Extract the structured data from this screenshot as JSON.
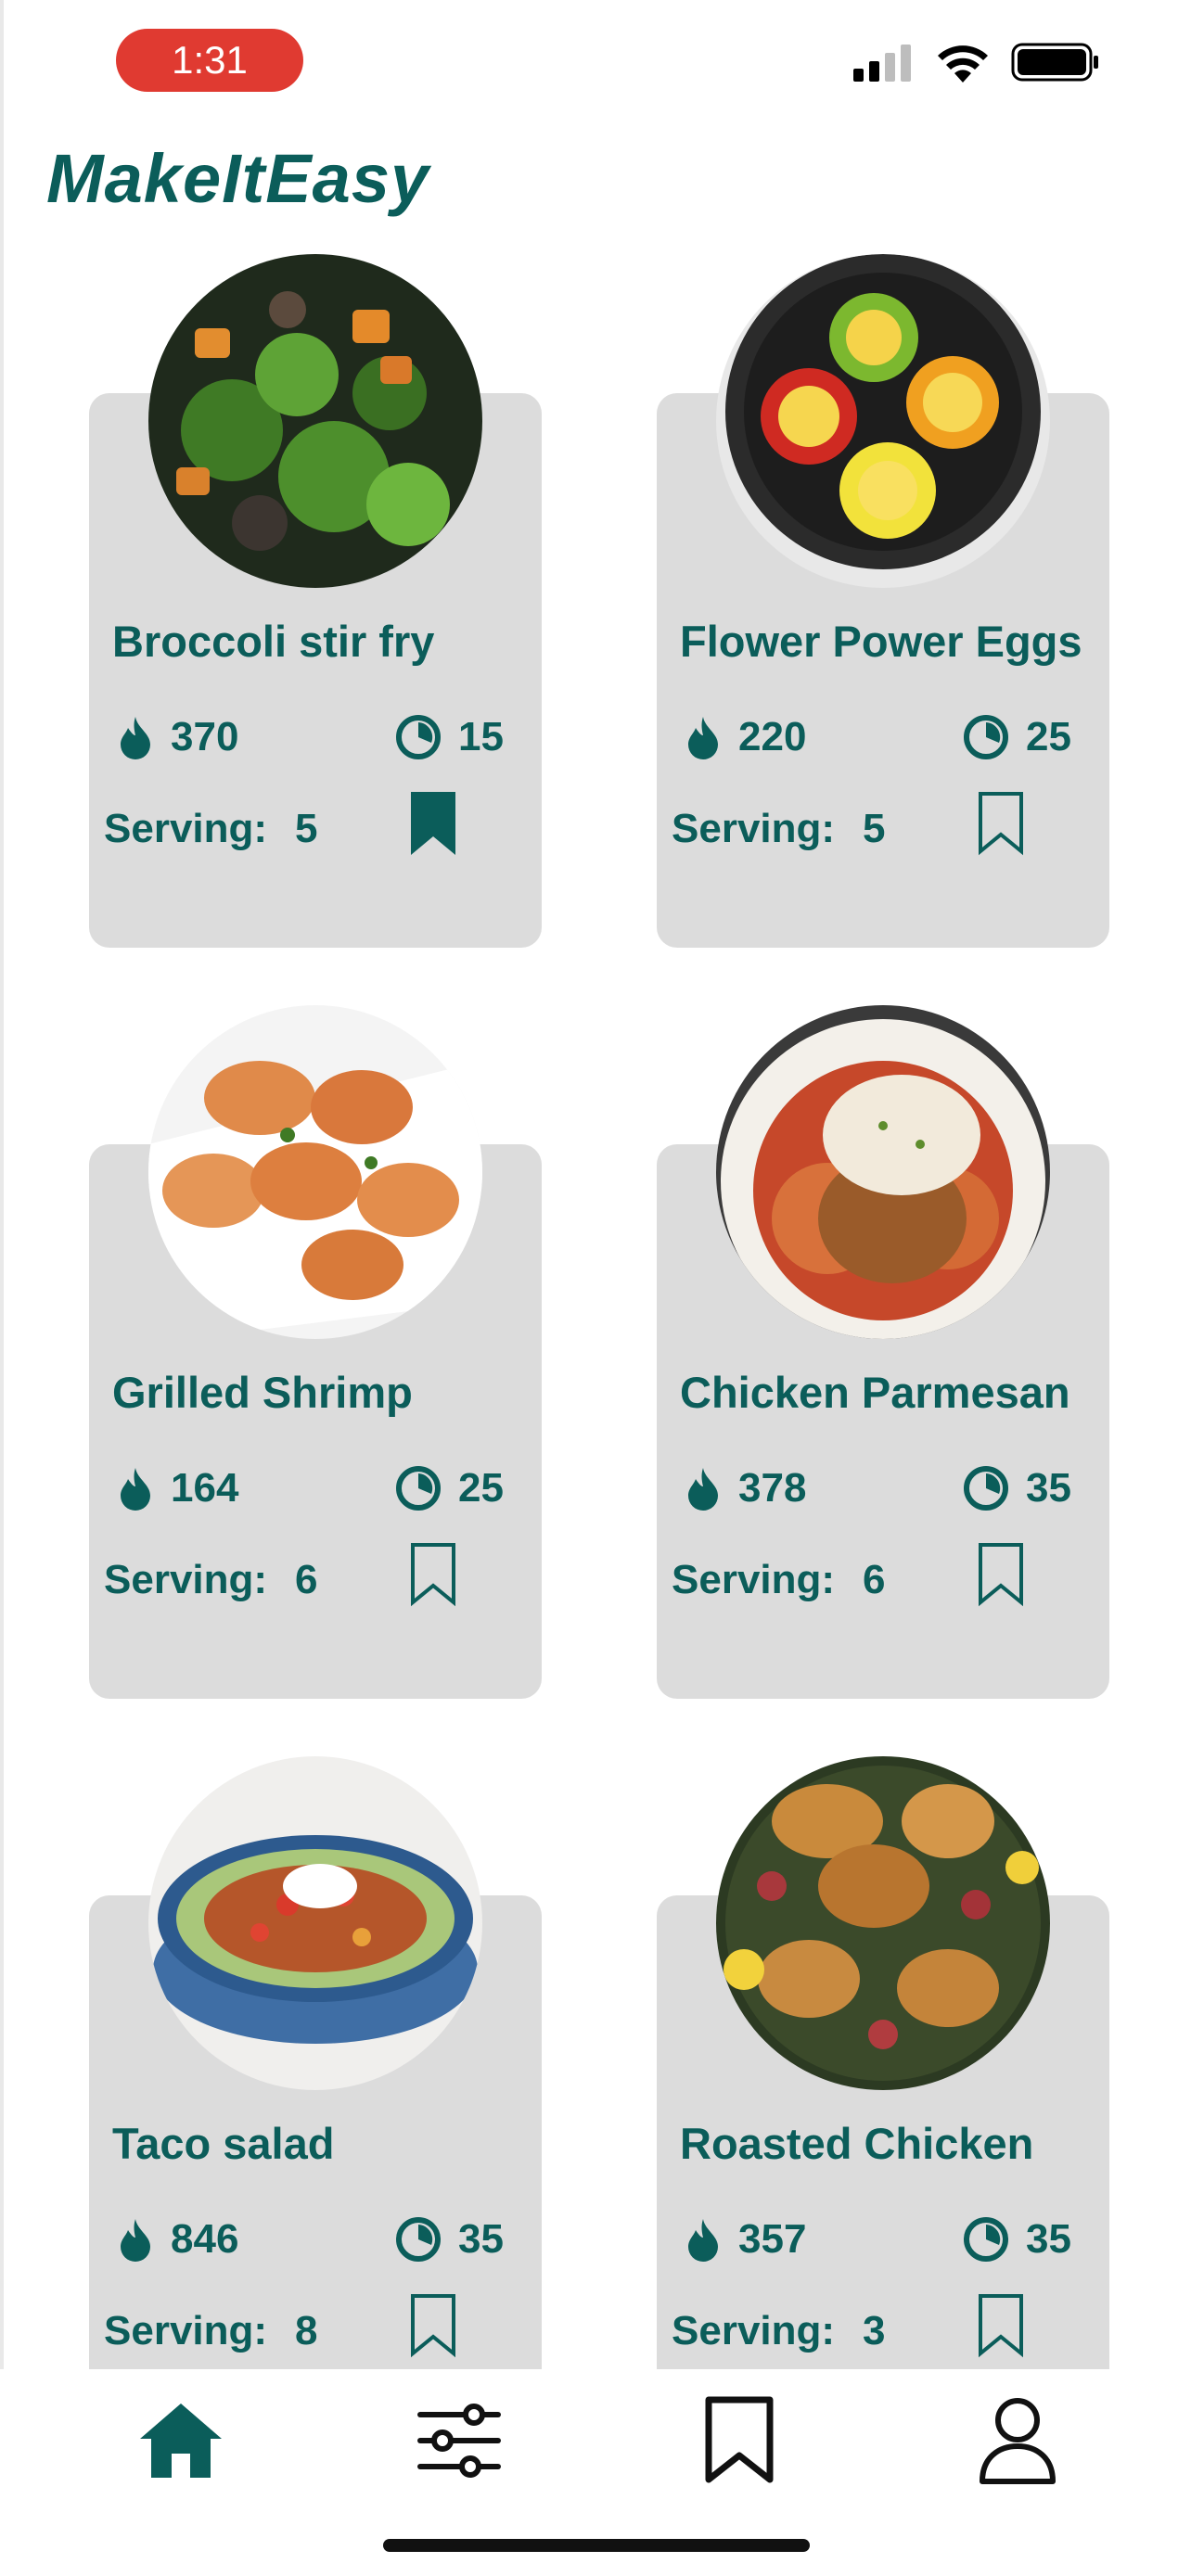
{
  "status_bar": {
    "time": "1:31"
  },
  "app": {
    "title": "MakeItEasy"
  },
  "colors": {
    "brand": "#0b5d5a",
    "card_bg": "#dcdcdc",
    "time_pill": "#e03a31"
  },
  "recipes": [
    {
      "name": "Broccoli stir fry",
      "calories": "370",
      "minutes": "15",
      "serving_label": "Serving:",
      "serving": "5",
      "bookmarked": true,
      "photo": "broccoli-stir-fry-photo"
    },
    {
      "name": "Flower Power Eggs",
      "calories": "220",
      "minutes": "25",
      "serving_label": "Serving:",
      "serving": "5",
      "bookmarked": false,
      "photo": "flower-power-eggs-photo"
    },
    {
      "name": "Grilled Shrimp",
      "calories": "164",
      "minutes": "25",
      "serving_label": "Serving:",
      "serving": "6",
      "bookmarked": false,
      "photo": "grilled-shrimp-photo"
    },
    {
      "name": "Chicken Parmesan",
      "calories": "378",
      "minutes": "35",
      "serving_label": "Serving:",
      "serving": "6",
      "bookmarked": false,
      "photo": "chicken-parmesan-photo"
    },
    {
      "name": "Taco salad",
      "calories": "846",
      "minutes": "35",
      "serving_label": "Serving:",
      "serving": "8",
      "bookmarked": false,
      "photo": "taco-salad-photo"
    },
    {
      "name": "Roasted Chicken",
      "calories": "357",
      "minutes": "35",
      "serving_label": "Serving:",
      "serving": "3",
      "bookmarked": false,
      "photo": "roasted-chicken-photo"
    }
  ],
  "tab_bar": {
    "tabs": [
      {
        "icon": "home-icon",
        "active": true
      },
      {
        "icon": "filter-sliders-icon",
        "active": false
      },
      {
        "icon": "bookmark-icon",
        "active": false
      },
      {
        "icon": "profile-icon",
        "active": false
      }
    ]
  }
}
